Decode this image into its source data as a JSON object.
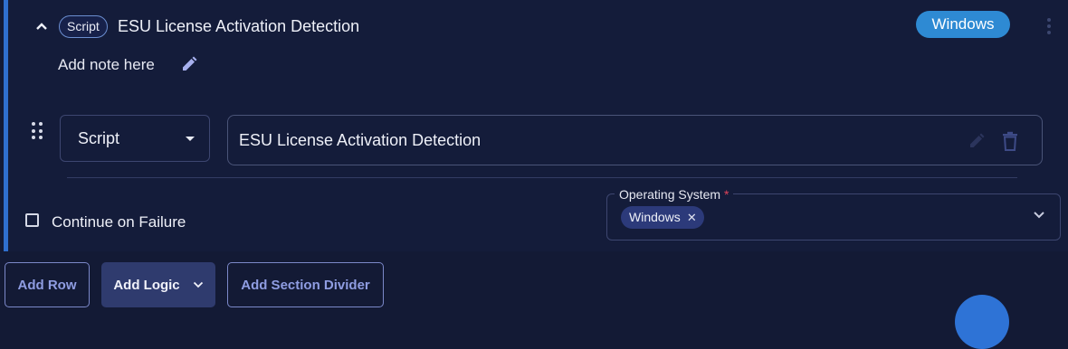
{
  "card": {
    "type_badge": "Script",
    "title": "ESU License Activation Detection",
    "os_pill": "Windows",
    "note": "Add note here"
  },
  "row": {
    "type_select": "Script",
    "text_value": "ESU License Activation Detection"
  },
  "options": {
    "continue_on_failure_label": "Continue on Failure",
    "continue_on_failure_checked": false,
    "os_field_label": "Operating System",
    "os_required_mark": "*",
    "os_chips": [
      "Windows"
    ],
    "chip_remove_glyph": "✕"
  },
  "actions": {
    "add_row": "Add Row",
    "add_logic": "Add Logic",
    "add_section_divider": "Add Section Divider"
  },
  "icons": {
    "collapse": "chevron-up-icon",
    "edit": "pencil-icon",
    "delete": "trash-icon",
    "drag": "drag-handle-icon",
    "menu": "kebab-menu-icon",
    "dropdown": "chevron-down-icon"
  },
  "colors": {
    "background": "#131a35",
    "accent_bar": "#2f6fcf",
    "os_pill": "#2e8ad3",
    "chip": "#2c3a7a",
    "required": "#e0445a",
    "button_text": "#8f9de2"
  }
}
